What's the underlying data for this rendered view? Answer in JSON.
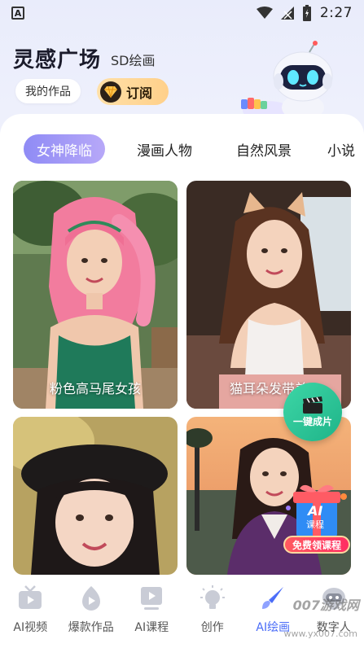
{
  "status_bar": {
    "app_badge": "A",
    "time": "2:27"
  },
  "header": {
    "title": "灵感广场",
    "subtitle": "SD绘画",
    "my_works_label": "我的作品",
    "subscribe_label": "订阅"
  },
  "tabs": [
    {
      "label": "女神降临",
      "active": true
    },
    {
      "label": "漫画人物",
      "active": false
    },
    {
      "label": "自然风景",
      "active": false
    },
    {
      "label": "小说",
      "active": false
    }
  ],
  "cards": [
    {
      "caption": "粉色高马尾女孩"
    },
    {
      "caption": "猫耳朵发带美"
    },
    {
      "caption": ""
    },
    {
      "caption": ""
    }
  ],
  "fab": {
    "label": "一键成片"
  },
  "promo": {
    "badge": "AI",
    "sub": "课程",
    "label": "免费领课程"
  },
  "bottom_nav": [
    {
      "label": "AI视频",
      "icon": "tv-icon",
      "active": false
    },
    {
      "label": "爆款作品",
      "icon": "flame-play-icon",
      "active": false
    },
    {
      "label": "AI课程",
      "icon": "course-play-icon",
      "active": false
    },
    {
      "label": "创作",
      "icon": "bulb-icon",
      "active": false
    },
    {
      "label": "AI绘画",
      "icon": "brush-icon",
      "active": true
    },
    {
      "label": "数字人",
      "icon": "robot-icon",
      "active": false
    }
  ],
  "watermark": {
    "text": "007游戏网",
    "url": "www.yx007.com"
  },
  "colors": {
    "accent": "#4a6cf7",
    "tab_active": "#9b92f6",
    "fab": "#2cc495"
  }
}
